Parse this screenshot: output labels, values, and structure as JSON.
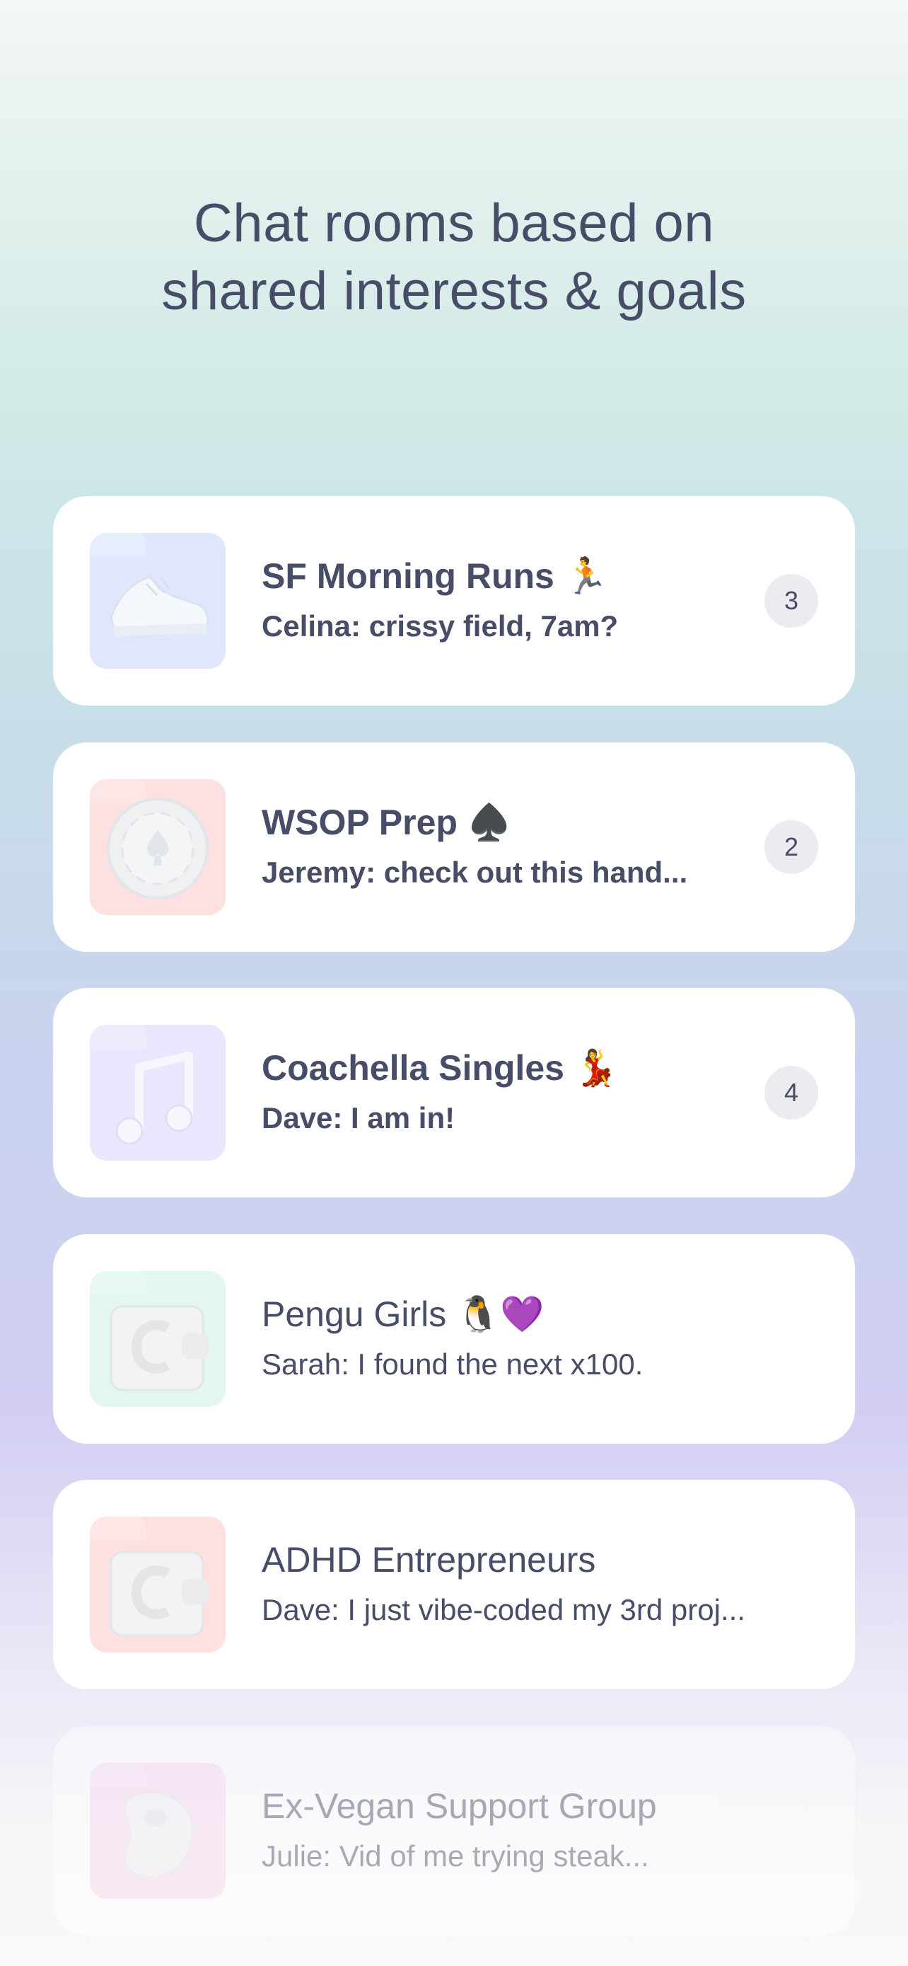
{
  "headline": {
    "line1": "Chat rooms based on",
    "line2": "shared interests & goals"
  },
  "rooms": [
    {
      "title": "SF Morning Runs 🏃",
      "preview": "Celina: crissy field, 7am?",
      "unread": "3",
      "icon": "sneaker-icon",
      "color": "#dfe6fd"
    },
    {
      "title": "WSOP Prep ♠️",
      "preview": "Jeremy: check out this hand...",
      "unread": "2",
      "icon": "poker-chip-icon",
      "color": "#fde0e0"
    },
    {
      "title": "Coachella Singles 💃",
      "preview": "Dave: I am in!",
      "unread": "4",
      "icon": "music-note-icon",
      "color": "#ebe6fd"
    },
    {
      "title": "Pengu Girls 🐧💜",
      "preview": "Sarah: I found the next x100.",
      "icon": "wallet-icon",
      "color": "#e3f7ef"
    },
    {
      "title": "ADHD Entrepreneurs",
      "preview": "Dave: I just vibe-coded my 3rd proj...",
      "icon": "wallet-icon",
      "color": "#fde0e0"
    },
    {
      "title": "Ex-Vegan Support Group",
      "preview": "Julie: Vid of me trying steak...",
      "icon": "steak-icon",
      "color": "#fbd8f0"
    }
  ]
}
